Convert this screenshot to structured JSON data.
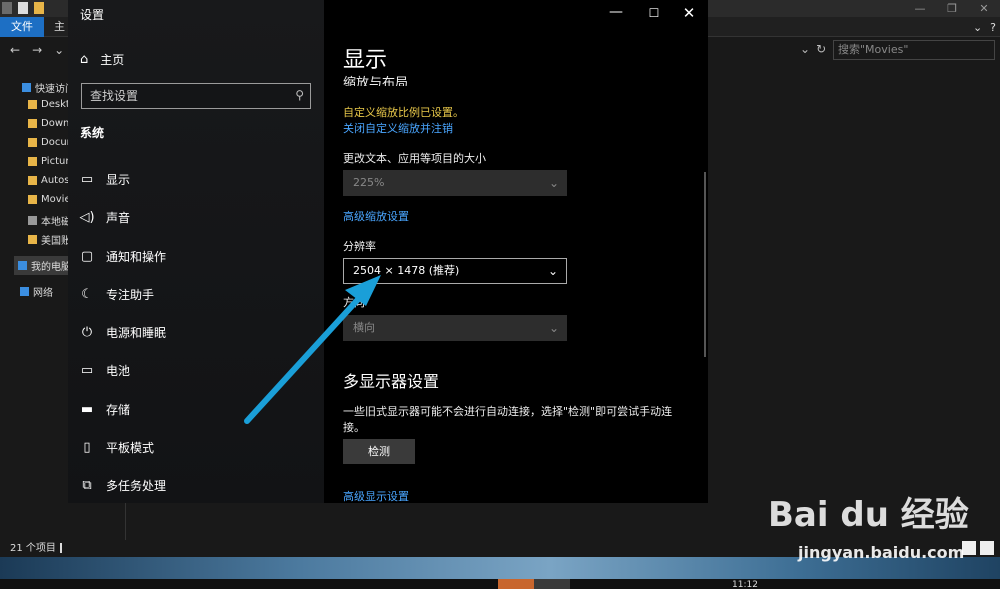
{
  "explorer": {
    "tab_file": "文件",
    "tab_home": "主",
    "search_placeholder": "搜索\"Movies\"",
    "sidebar": [
      {
        "label": "快速访问",
        "icon": "star-icon"
      },
      {
        "label": "Deskto",
        "icon": "folder-icon"
      },
      {
        "label": "Down",
        "icon": "folder-icon"
      },
      {
        "label": "Docum",
        "icon": "folder-icon"
      },
      {
        "label": "Picture",
        "icon": "folder-icon"
      },
      {
        "label": "Autos",
        "icon": "folder-icon"
      },
      {
        "label": "Movie",
        "icon": "folder-icon"
      },
      {
        "label": "本地磁",
        "icon": "drive-icon"
      },
      {
        "label": "美国账",
        "icon": "folder-icon"
      },
      {
        "label": "我的电脑",
        "icon": "computer-icon"
      },
      {
        "label": "网络",
        "icon": "network-icon"
      }
    ],
    "status_count": "21 个项目"
  },
  "settings": {
    "title": "设置",
    "home_label": "主页",
    "search_placeholder": "查找设置",
    "system_heading": "系统",
    "nav": [
      {
        "label": "显示",
        "icon": "monitor-icon",
        "name": "nav-item-display",
        "active": true
      },
      {
        "label": "声音",
        "icon": "speaker-icon",
        "name": "nav-item-sound"
      },
      {
        "label": "通知和操作",
        "icon": "notification-icon",
        "name": "nav-item-notifications"
      },
      {
        "label": "专注助手",
        "icon": "moon-icon",
        "name": "nav-item-focus-assist"
      },
      {
        "label": "电源和睡眠",
        "icon": "power-icon",
        "name": "nav-item-power-sleep"
      },
      {
        "label": "电池",
        "icon": "battery-icon",
        "name": "nav-item-battery"
      },
      {
        "label": "存储",
        "icon": "storage-icon",
        "name": "nav-item-storage"
      },
      {
        "label": "平板模式",
        "icon": "tablet-icon",
        "name": "nav-item-tablet-mode"
      },
      {
        "label": "多任务处理",
        "icon": "multitask-icon",
        "name": "nav-item-multitasking"
      }
    ],
    "page_title": "显示",
    "scale_section": "缩放与布局",
    "custom_scale_warning": "自定义缩放比例已设置。",
    "turn_off_custom_scaling": "关闭自定义缩放并注销",
    "text_size_label": "更改文本、应用等项目的大小",
    "scale_value": "225%",
    "advanced_scaling": "高级缩放设置",
    "resolution_label": "分辨率",
    "resolution_value": "2504 × 1478 (推荐)",
    "orientation_label": "方向",
    "orientation_value": "横向",
    "multi_display_heading": "多显示器设置",
    "multi_display_desc": "一些旧式显示器可能不会进行自动连接，选择\"检测\"即可尝试手动连接。",
    "detect_button": "检测",
    "advanced_display": "高级显示设置"
  },
  "taskbar": {
    "clock": "11:12"
  },
  "watermark": {
    "logo": "Bai du 经验",
    "url": "jingyan.baidu.com"
  },
  "colors": {
    "accent_blue": "#1d6fc4",
    "link_blue": "#4aa6ff",
    "warning_yellow": "#e8c84a",
    "arrow_cyan": "#1a9fd8"
  }
}
